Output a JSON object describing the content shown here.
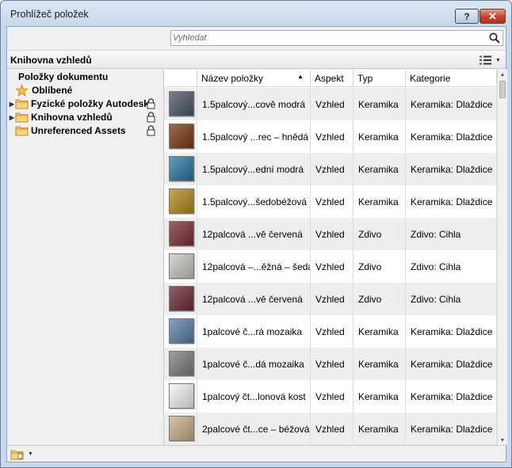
{
  "window": {
    "title": "Prohlížeč položek",
    "help_label": "?",
    "close_label": "✕"
  },
  "search": {
    "placeholder": "Vyhledat",
    "value": ""
  },
  "library": {
    "title": "Knihovna vzhledů"
  },
  "tree": {
    "root_label": "Položky dokumentu",
    "favorites_label": "Oblíbené",
    "items": [
      {
        "label": "Fyzické položky Autodesk",
        "locked": true
      },
      {
        "label": "Knihovna vzhledů",
        "locked": true
      },
      {
        "label": "Unreferenced Assets",
        "locked": true
      }
    ]
  },
  "grid": {
    "columns": {
      "name": "Název položky",
      "aspect": "Aspekt",
      "type": "Typ",
      "category": "Kategorie"
    },
    "rows": [
      {
        "name": "1.5palcový...cově modrá",
        "aspect": "Vzhled",
        "type": "Keramika",
        "category": "Keramika: Dlaždice",
        "swatch": "#4d5566"
      },
      {
        "name": "1.5palcový ...rec – hnědá",
        "aspect": "Vzhled",
        "type": "Keramika",
        "category": "Keramika: Dlaždice",
        "swatch": "#7a3a14"
      },
      {
        "name": "1.5palcový...ední modrá",
        "aspect": "Vzhled",
        "type": "Keramika",
        "category": "Keramika: Dlaždice",
        "swatch": "#2a78a0"
      },
      {
        "name": "1.5palcový...šedobéžová",
        "aspect": "Vzhled",
        "type": "Keramika",
        "category": "Keramika: Dlaždice",
        "swatch": "#b28a1c"
      },
      {
        "name": "12palcová ...vě červená",
        "aspect": "Vzhled",
        "type": "Zdivo",
        "category": "Zdivo: Cihla",
        "swatch": "#7a2e35"
      },
      {
        "name": "12palcová –...ěžná – šedá",
        "aspect": "Vzhled",
        "type": "Zdivo",
        "category": "Zdivo: Cihla",
        "swatch": "#c8c8c4"
      },
      {
        "name": "12palcová ...vě červená",
        "aspect": "Vzhled",
        "type": "Zdivo",
        "category": "Zdivo: Cihla",
        "swatch": "#6e2a33"
      },
      {
        "name": "1palcové č...rá mozaika",
        "aspect": "Vzhled",
        "type": "Keramika",
        "category": "Keramika: Dlaždice",
        "swatch": "#5a7fa8"
      },
      {
        "name": "1palcové č...dá mozaika",
        "aspect": "Vzhled",
        "type": "Keramika",
        "category": "Keramika: Dlaždice",
        "swatch": "#7d7d7d"
      },
      {
        "name": "1palcový čt...lonová kost",
        "aspect": "Vzhled",
        "type": "Keramika",
        "category": "Keramika: Dlaždice",
        "swatch": "#f4f4f2"
      },
      {
        "name": "2palcové čt...ce – béžová",
        "aspect": "Vzhled",
        "type": "Keramika",
        "category": "Keramika: Dlaždice",
        "swatch": "#c9b08a"
      }
    ]
  }
}
